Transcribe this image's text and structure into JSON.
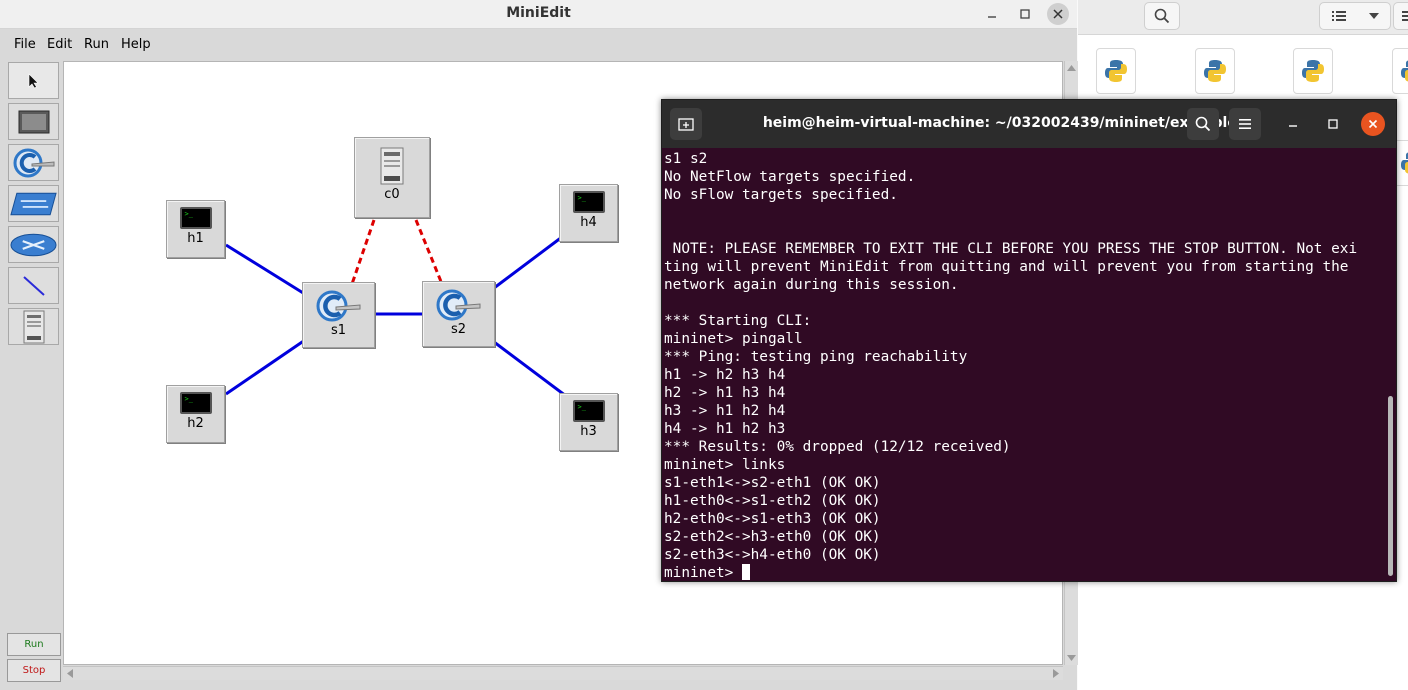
{
  "miniedit": {
    "title": "MiniEdit",
    "menu": [
      "File",
      "Edit",
      "Run",
      "Help"
    ],
    "palette": {
      "tools": [
        "select-pointer-icon",
        "host-icon",
        "switch-icon",
        "legacy-switch-icon",
        "router-icon",
        "link-icon",
        "controller-icon"
      ],
      "run_label": "Run",
      "stop_label": "Stop"
    },
    "nodes": {
      "c0": "c0",
      "h1": "h1",
      "h2": "h2",
      "h3": "h3",
      "h4": "h4",
      "s1": "s1",
      "s2": "s2"
    },
    "link_colors": {
      "data": "#0000dd",
      "control": "#dd0000"
    }
  },
  "terminal": {
    "title": "heim@heim-virtual-machine: ~/032002439/mininet/examples",
    "lines": [
      "s1 s2",
      "No NetFlow targets specified.",
      "No sFlow targets specified.",
      "",
      "",
      " NOTE: PLEASE REMEMBER TO EXIT THE CLI BEFORE YOU PRESS THE STOP BUTTON. Not exi",
      "ting will prevent MiniEdit from quitting and will prevent you from starting the",
      "network again during this session.",
      "",
      "*** Starting CLI:",
      "mininet> pingall",
      "*** Ping: testing ping reachability",
      "h1 -> h2 h3 h4",
      "h2 -> h1 h3 h4",
      "h3 -> h1 h2 h4",
      "h4 -> h1 h2 h3",
      "*** Results: 0% dropped (12/12 received)",
      "mininet> links",
      "s1-eth1<->s2-eth1 (OK OK)",
      "h1-eth0<->s1-eth2 (OK OK)",
      "h2-eth0<->s1-eth3 (OK OK)",
      "s2-eth2<->h3-eth0 (OK OK)",
      "s2-eth3<->h4-eth0 (OK OK)"
    ],
    "prompt": "mininet> ",
    "colors": {
      "background": "#300a24",
      "header": "#2c2c2c",
      "close": "#e95420"
    }
  },
  "file_manager": {
    "files": [
      "python-file-icon",
      "python-file-icon",
      "python-file-icon",
      "python-file-icon"
    ]
  }
}
